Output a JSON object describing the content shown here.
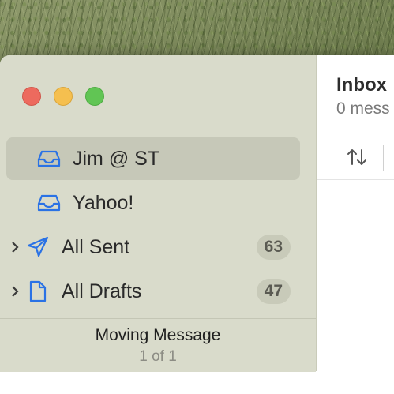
{
  "window": {
    "traffic_lights": {
      "close": "#ed6a5e",
      "minimize": "#f5bf4f",
      "zoom": "#61c554"
    }
  },
  "sidebar": {
    "items": [
      {
        "label": "Jim @ ST",
        "icon": "inbox-tray-icon",
        "selected": true,
        "badge": ""
      },
      {
        "label": "Yahoo!",
        "icon": "inbox-tray-icon",
        "selected": false,
        "badge": ""
      },
      {
        "label": "All Sent",
        "icon": "paper-plane-icon",
        "selected": false,
        "badge": "63",
        "expandable": true
      },
      {
        "label": "All Drafts",
        "icon": "document-icon",
        "selected": false,
        "badge": "47",
        "expandable": true
      }
    ],
    "accent_color": "#2a72e5"
  },
  "status": {
    "title": "Moving Message",
    "progress": "1 of 1"
  },
  "main": {
    "title": "Inbox",
    "count": "0 mess",
    "sort_icon": "sort-arrows-icon"
  }
}
